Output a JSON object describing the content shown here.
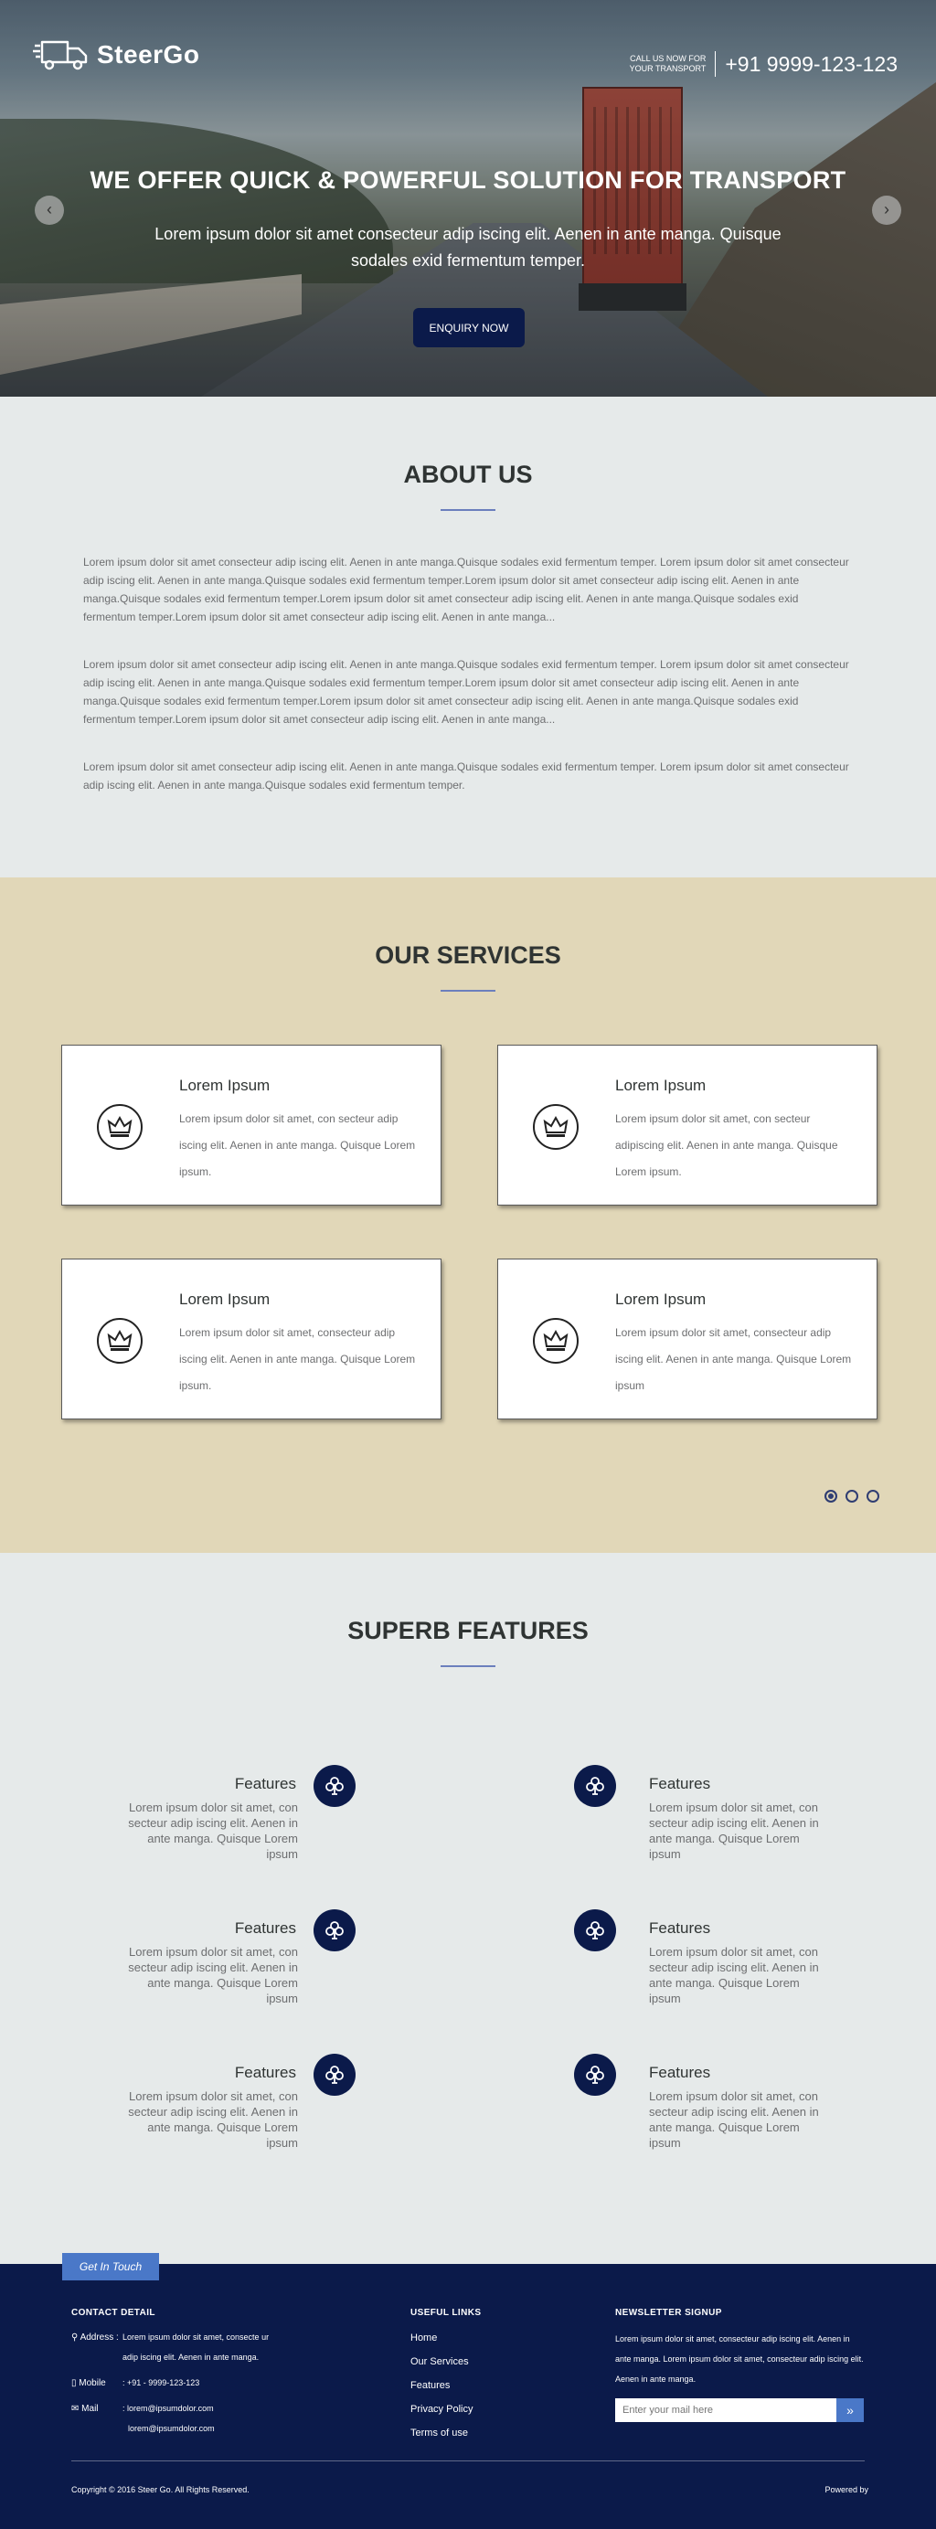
{
  "hero": {
    "brand": "SteerGo",
    "call_label": "CALL US NOW FOR YOUR TRANSPORT",
    "phone": "+91 9999-123-123",
    "title": "WE OFFER QUICK & POWERFUL SOLUTION FOR TRANSPORT",
    "subtitle": "Lorem ipsum dolor sit amet consecteur adip iscing elit. Aenen in ante manga. Quisque sodales exid fermentum temper.",
    "enquiry_label": "ENQUIRY NOW",
    "prev_arrow": "‹",
    "next_arrow": "›"
  },
  "about": {
    "title": "ABOUT US",
    "paragraphs": [
      "Lorem ipsum dolor sit amet consecteur adip iscing elit. Aenen in ante manga.Quisque sodales exid fermentum temper. Lorem ipsum dolor sit amet consecteur adip iscing elit. Aenen in ante manga.Quisque sodales exid fermentum temper.Lorem ipsum dolor sit amet consecteur adip iscing elit. Aenen in ante manga.Quisque sodales exid fermentum temper.Lorem ipsum dolor sit amet consecteur adip iscing elit. Aenen in ante manga.Quisque sodales exid fermentum temper.Lorem ipsum dolor sit amet consecteur adip iscing elit. Aenen in ante manga...",
      "Lorem ipsum dolor sit amet consecteur adip iscing elit. Aenen in ante manga.Quisque sodales exid fermentum temper. Lorem ipsum dolor sit amet consecteur adip iscing elit. Aenen in ante manga.Quisque sodales exid fermentum temper.Lorem ipsum dolor sit amet consecteur adip iscing elit. Aenen in ante manga.Quisque sodales exid fermentum temper.Lorem ipsum dolor sit amet consecteur adip iscing elit. Aenen in ante manga.Quisque sodales exid fermentum temper.Lorem ipsum dolor sit amet consecteur adip iscing elit. Aenen in ante manga...",
      "Lorem ipsum dolor sit amet consecteur adip iscing elit. Aenen in ante manga.Quisque sodales exid fermentum temper. Lorem ipsum dolor sit amet consecteur adip iscing elit. Aenen in ante manga.Quisque sodales exid fermentum temper."
    ]
  },
  "services": {
    "title": "OUR SERVICES",
    "cards": [
      {
        "title": "Lorem Ipsum",
        "text": "Lorem ipsum dolor sit amet, con secteur adip iscing elit. Aenen in ante manga. Quisque Lorem ipsum.",
        "icon": "crown-icon"
      },
      {
        "title": "Lorem Ipsum",
        "text": "Lorem ipsum dolor sit amet, con secteur adipiscing elit. Aenen in ante manga. Quisque Lorem ipsum.",
        "icon": "crown-icon"
      },
      {
        "title": "Lorem Ipsum",
        "text": "Lorem ipsum dolor sit amet, consecteur adip iscing elit. Aenen in ante manga. Quisque Lorem ipsum.",
        "icon": "crown-icon"
      },
      {
        "title": "Lorem Ipsum",
        "text": "Lorem ipsum dolor sit amet, consecteur adip iscing elit. Aenen in ante manga. Quisque Lorem ipsum",
        "icon": "crown-icon"
      }
    ],
    "pager_active": 1,
    "pager_count": 3
  },
  "features": {
    "title": "SUPERB FEATURES",
    "items": [
      {
        "title": "Features",
        "text": "Lorem ipsum dolor sit amet, con secteur adip iscing elit. Aenen in ante manga. Quisque Lorem ipsum",
        "icon": "club-icon"
      },
      {
        "title": "Features",
        "text": "Lorem ipsum dolor sit amet, con secteur adip iscing elit. Aenen in ante manga. Quisque Lorem ipsum",
        "icon": "club-icon"
      },
      {
        "title": "Features",
        "text": "Lorem ipsum dolor sit amet, con secteur adip iscing elit. Aenen in ante manga. Quisque Lorem ipsum",
        "icon": "club-icon"
      },
      {
        "title": "Features",
        "text": "Lorem ipsum dolor sit amet, con secteur adip iscing elit. Aenen in ante manga. Quisque Lorem ipsum",
        "icon": "club-icon"
      },
      {
        "title": "Features",
        "text": "Lorem ipsum dolor sit amet, con secteur adip iscing elit. Aenen in ante manga. Quisque Lorem ipsum",
        "icon": "club-icon"
      },
      {
        "title": "Features",
        "text": "Lorem ipsum dolor sit amet, con secteur adip iscing elit. Aenen in ante manga. Quisque Lorem ipsum",
        "icon": "club-icon"
      }
    ]
  },
  "footer": {
    "get_in_touch": "Get In Touch",
    "contact_title": "CONTACT DETAIL",
    "address_label": "Address :",
    "address_value": "Lorem ipsum dolor sit amet, consecte ur adip iscing elit. Aenen in ante manga.",
    "mobile_label": "Mobile",
    "mobile_value": ": +91 - 9999-123-123",
    "mail_label": "Mail",
    "mail_value_1": ": lorem@ipsumdolor.com",
    "mail_value_2": "lorem@ipsumdolor.com",
    "links_title": "USEFUL LINKS",
    "links": [
      "Home",
      "Our Services",
      "Features",
      "Privacy Policy",
      "Terms of use"
    ],
    "newsletter_title": "NEWSLETTER SIGNUP",
    "newsletter_text": "Lorem ipsum dolor sit amet, consecteur adip iscing elit. Aenen in ante manga. Lorem ipsum dolor sit amet, consecteur adip iscing elit. Aenen in ante manga.",
    "newsletter_placeholder": "Enter your mail here",
    "newsletter_button": "»",
    "copyright": "Copyright © 2016 Steer Go. All Rights Reserved.",
    "powered": "Powered by"
  },
  "colors": {
    "navy": "#0b1a4a",
    "accent_blue": "#4a78c8",
    "services_bg": "#e1d7b8",
    "page_bg": "#e6eaea"
  }
}
